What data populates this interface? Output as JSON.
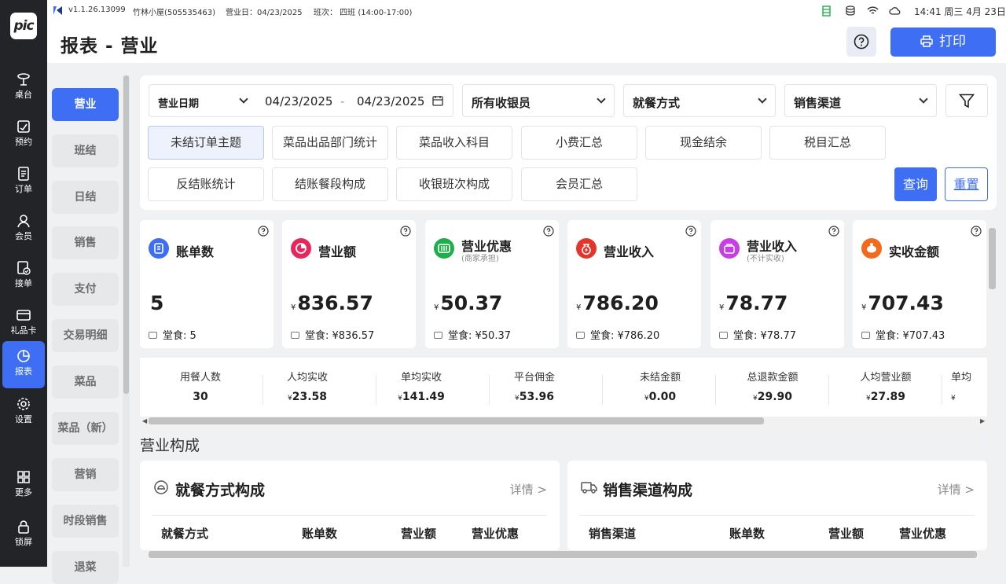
{
  "app": {
    "logo": "pic",
    "version": "v1.1.26.13099",
    "store": "竹林小屋(505535463)",
    "business_day": "营业日：04/23/2025",
    "shift": "班次： 四班 (14:00-17:00)",
    "clock": "14:41 周三 4月 23日"
  },
  "nav": [
    {
      "label": "桌台",
      "icon": "table-icon"
    },
    {
      "label": "预约",
      "icon": "reservation-icon"
    },
    {
      "label": "订单",
      "icon": "order-icon"
    },
    {
      "label": "会员",
      "icon": "member-icon"
    },
    {
      "label": "接单",
      "icon": "accept-order-icon"
    },
    {
      "label": "礼品卡",
      "icon": "gift-card-icon"
    },
    {
      "label": "报表",
      "icon": "report-icon"
    },
    {
      "label": "设置",
      "icon": "settings-icon"
    },
    {
      "label": "更多",
      "icon": "more-grid-icon"
    },
    {
      "label": "锁屏",
      "icon": "lock-icon"
    }
  ],
  "header": {
    "title": "报表 - 营业",
    "print_label": "打印"
  },
  "subnav": [
    "营业",
    "班结",
    "日结",
    "销售",
    "支付",
    "交易明细",
    "菜品",
    "菜品（新）",
    "营销",
    "时段销售",
    "退菜"
  ],
  "filters": {
    "date_type": "营业日期",
    "date_from": "04/23/2025",
    "date_sep": "-",
    "date_to": "04/23/2025",
    "cashier": "所有收银员",
    "dining": "就餐方式",
    "channel": "销售渠道"
  },
  "tags": [
    "未结订单主题",
    "菜品出品部门统计",
    "菜品收入科目",
    "小费汇总",
    "现金结余",
    "税目汇总",
    "反结账统计",
    "结账餐段构成",
    "收银班次构成",
    "会员汇总"
  ],
  "actions": {
    "query": "查询",
    "reset": "重置"
  },
  "stats": [
    {
      "name": "账单数",
      "sub": "",
      "currency": "",
      "value": "5",
      "detail": "堂食:  5",
      "color": "#3d6ef3"
    },
    {
      "name": "营业额",
      "sub": "",
      "currency": "¥",
      "value": "836.57",
      "detail": "堂食:  ¥836.57",
      "color": "#e8265b"
    },
    {
      "name": "营业优惠",
      "sub": "(商家承担)",
      "currency": "¥",
      "value": "50.37",
      "detail": "堂食:  ¥50.37",
      "color": "#1fae4b"
    },
    {
      "name": "营业收入",
      "sub": "",
      "currency": "¥",
      "value": "786.20",
      "detail": "堂食:  ¥786.20",
      "color": "#e5352b"
    },
    {
      "name": "营业收入",
      "sub": "(不计实收)",
      "currency": "¥",
      "value": "78.77",
      "detail": "堂食:  ¥78.77",
      "color": "#c63fe3"
    },
    {
      "name": "实收金额",
      "sub": "",
      "currency": "¥",
      "value": "707.43",
      "detail": "堂食:  ¥707.43",
      "color": "#f26b1d"
    }
  ],
  "metrics": [
    {
      "label": "用餐人数",
      "currency": "",
      "value": "30"
    },
    {
      "label": "人均实收",
      "currency": "¥",
      "value": "23.58"
    },
    {
      "label": "单均实收",
      "currency": "¥",
      "value": "141.49"
    },
    {
      "label": "平台佣金",
      "currency": "¥",
      "value": "53.96"
    },
    {
      "label": "未结金额",
      "currency": "¥",
      "value": "0.00"
    },
    {
      "label": "总退款金额",
      "currency": "¥",
      "value": "29.90"
    },
    {
      "label": "人均营业额",
      "currency": "¥",
      "value": "27.89"
    },
    {
      "label": "单均",
      "currency": "¥",
      "value": ""
    }
  ],
  "section_title": "营业构成",
  "panels": [
    {
      "title": "就餐方式构成",
      "more": "详情 >",
      "cols": [
        "就餐方式",
        "账单数",
        "营业额",
        "营业优惠"
      ]
    },
    {
      "title": "销售渠道构成",
      "more": "详情 >",
      "cols": [
        "销售渠道",
        "账单数",
        "营业额",
        "营业优惠"
      ]
    }
  ]
}
